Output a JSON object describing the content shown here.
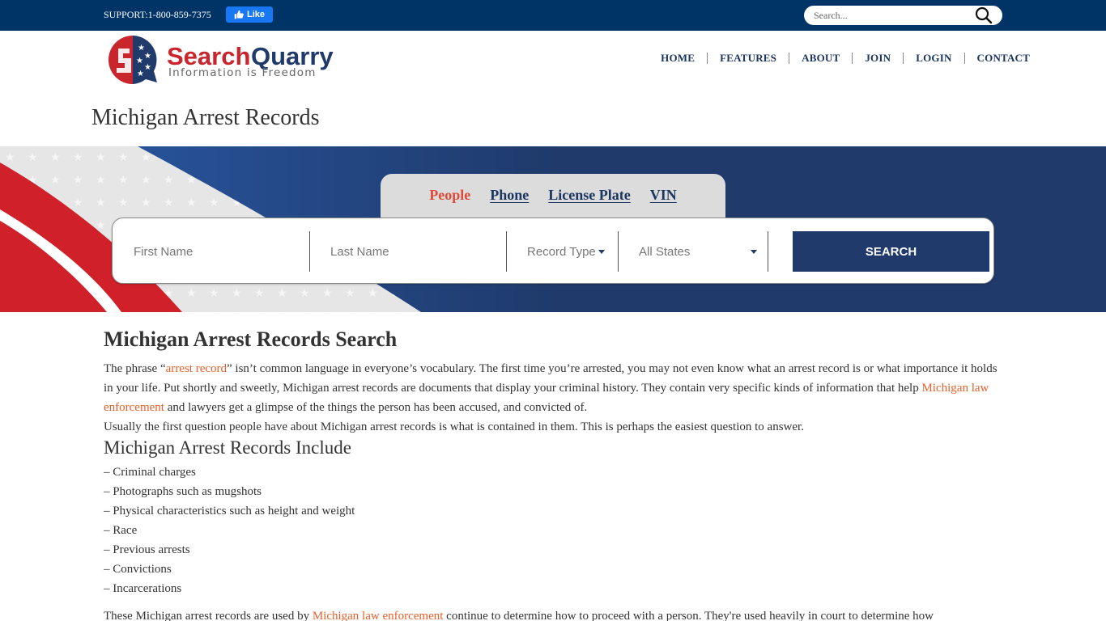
{
  "topbar": {
    "support_text": "SUPPORT:1-800-859-7375",
    "like_label": "Like",
    "search_placeholder": "Search..."
  },
  "logo": {
    "brand_part1": "Search",
    "brand_part2": "Quarry",
    "tagline": "Information is Freedom"
  },
  "nav": {
    "items": [
      {
        "label": "HOME"
      },
      {
        "label": "FEATURES"
      },
      {
        "label": "ABOUT"
      },
      {
        "label": "JOIN"
      },
      {
        "label": "LOGIN"
      },
      {
        "label": "CONTACT"
      }
    ]
  },
  "page": {
    "title": "Michigan Arrest Records"
  },
  "search": {
    "tabs": [
      {
        "label": "People",
        "active": true
      },
      {
        "label": "Phone",
        "active": false
      },
      {
        "label": "License Plate",
        "active": false
      },
      {
        "label": "VIN",
        "active": false
      }
    ],
    "first_name_placeholder": "First Name",
    "last_name_placeholder": "Last Name",
    "record_type_label": "Record Type",
    "state_label": "All States",
    "button_label": "SEARCH"
  },
  "content": {
    "heading": "Michigan Arrest Records Search",
    "p1_a": "The phrase “",
    "p1_link1": "arrest record",
    "p1_b": "” isn’t common language in everyone’s vocabulary. The first time you’re arrested, you may not even know what an arrest record is or what importance it holds in your life. Put shortly and sweetly, Michigan arrest records are documents that display your criminal history. They contain very specific kinds of information that help ",
    "p1_link2": "Michigan law enforcement",
    "p1_c": " and lawyers get a glimpse of the things the person has been accused, and convicted of.",
    "p2": "Usually the first question people have about Michigan arrest records is what is contained in them. This is perhaps the easiest question to answer.",
    "subheading": "Michigan Arrest Records Include",
    "list": [
      "– Criminal charges",
      "– Photographs such as mugshots",
      "– Physical characteristics such as height and weight",
      "– Race",
      "– Previous arrests",
      "– Convictions",
      "– Incarcerations"
    ],
    "p3_a": "These Michigan arrest records are used by ",
    "p3_link": "Michigan law enforcement",
    "p3_b": " continue to determine how to proceed with a person. They're used heavily in court to determine how"
  },
  "colors": {
    "topbar": "#003366",
    "navy": "#1f3a6b",
    "accent_red": "#e04a3a",
    "link_orange": "#e8602c"
  }
}
